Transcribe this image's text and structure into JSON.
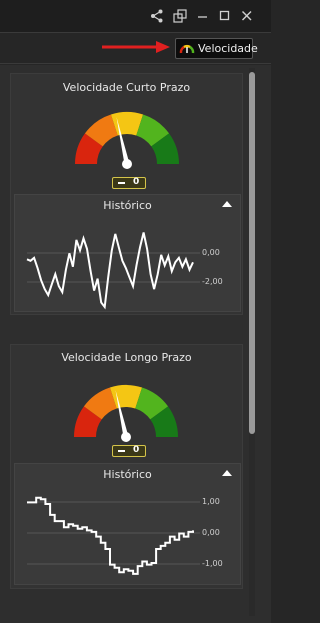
{
  "toolbar": {
    "speed_button_label": "Velocidade",
    "icons": [
      "share-icon",
      "popout-icon",
      "minimize-icon",
      "maximize-icon",
      "close-icon"
    ]
  },
  "colors": {
    "gauge_red": "#d9250e",
    "gauge_orange": "#f07a12",
    "gauge_yellow": "#f4c614",
    "gauge_lightgreen": "#52b41e",
    "gauge_darkgreen": "#187a18",
    "arrow": "#e02020",
    "badge_border": "#d4c44a"
  },
  "panels": [
    {
      "title": "Velocidade Curto Prazo",
      "gauge_value": 0,
      "badge_value": "0",
      "history_title": "Histórico",
      "history_ticks": [
        "0,00",
        "-2,00"
      ]
    },
    {
      "title": "Velocidade Longo Prazo",
      "gauge_value": 0,
      "badge_value": "0",
      "history_title": "Histórico",
      "history_ticks": [
        "1,00",
        "0,00",
        "-1,00"
      ]
    }
  ],
  "chart_data": [
    {
      "type": "line",
      "title": "Histórico",
      "yticks": [
        "0,00",
        "-2,00"
      ],
      "ylim": [
        -3,
        2.5
      ],
      "series": [
        {
          "values": [
            0.2,
            0.1,
            0.3,
            -0.4,
            -1.2,
            -1.8,
            -2.2,
            -1.5,
            -0.8,
            -1.6,
            -2.0,
            -0.5,
            0.6,
            -0.3,
            1.5,
            0.8,
            1.6,
            0.9,
            -0.6,
            -1.9,
            -1.1,
            -2.7,
            -3.0,
            -1.0,
            0.8,
            1.9,
            1.0,
            0.1,
            -0.4,
            -1.0,
            -1.6,
            -0.2,
            1.0,
            2.0,
            0.9,
            -0.8,
            -1.8,
            -0.8,
            0.5,
            -0.2,
            0.4,
            -0.6,
            0.0,
            0.3,
            -0.3,
            0.2,
            -0.5,
            0.0
          ]
        }
      ]
    },
    {
      "type": "line",
      "title": "Histórico",
      "yticks": [
        "1,00",
        "0,00",
        "-1,00"
      ],
      "ylim": [
        -1.4,
        1.4
      ],
      "series": [
        {
          "values": [
            1.0,
            1.0,
            1.15,
            1.1,
            0.95,
            0.6,
            0.4,
            0.4,
            0.2,
            0.3,
            0.25,
            0.15,
            0.2,
            0.1,
            0.05,
            -0.1,
            -0.3,
            -0.5,
            -1.0,
            -1.1,
            -1.25,
            -1.15,
            -1.2,
            -1.3,
            -1.05,
            -0.9,
            -1.0,
            -0.95,
            -0.5,
            -0.4,
            -0.3,
            -0.1,
            -0.2,
            0.0,
            -0.1,
            0.05,
            0.1
          ]
        }
      ]
    }
  ]
}
